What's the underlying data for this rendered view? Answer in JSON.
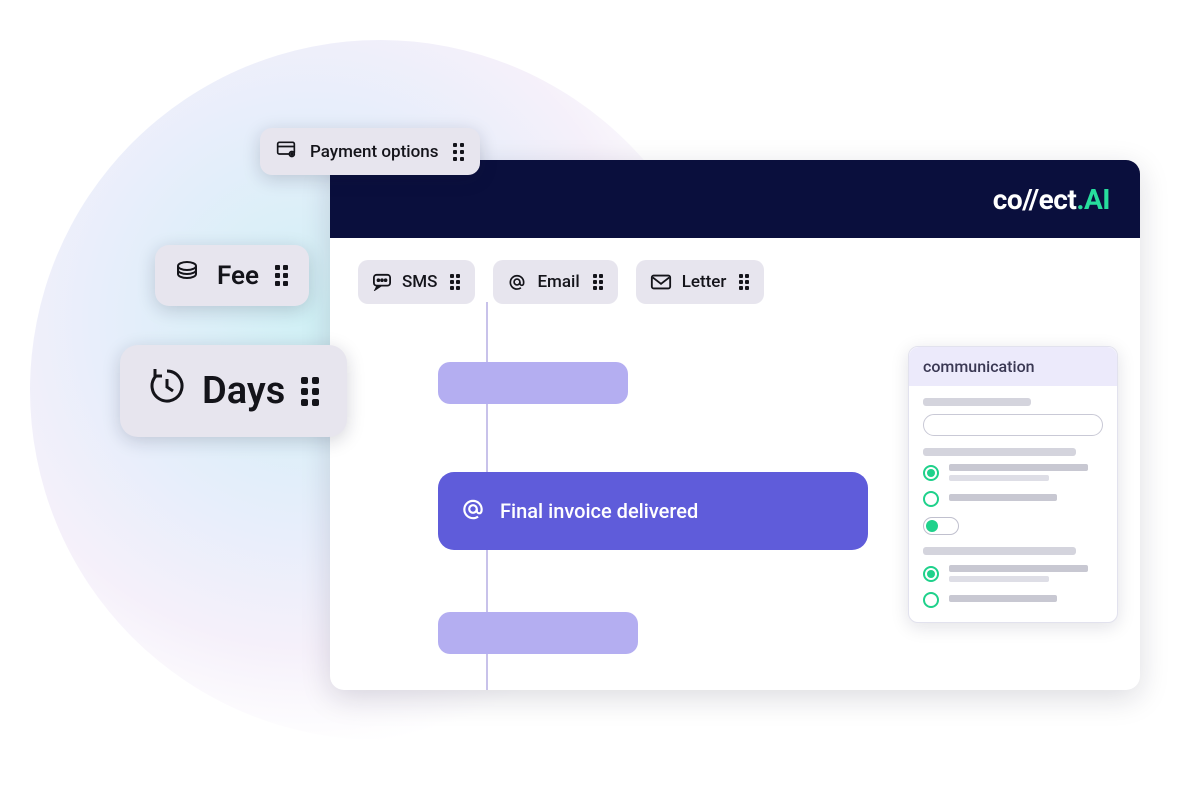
{
  "brand": {
    "name_part1": "co//ect",
    "name_part2": ".AI"
  },
  "channels": {
    "sms": "SMS",
    "email": "Email",
    "letter": "Letter"
  },
  "timeline": {
    "main_event": "Final invoice delivered"
  },
  "side_panel": {
    "title": "communication"
  },
  "floating": {
    "payment_options": "Payment options",
    "fee": "Fee",
    "days": "Days"
  }
}
